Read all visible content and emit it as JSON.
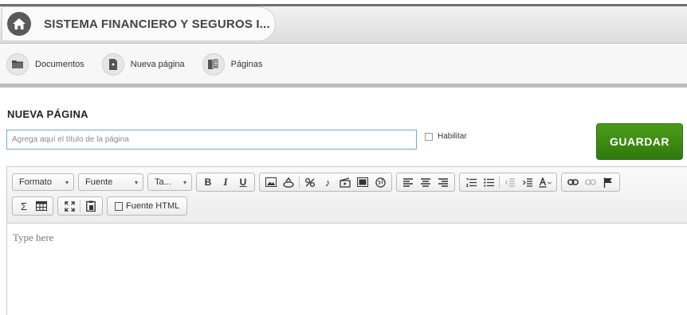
{
  "header": {
    "site_title": "SISTEMA FINANCIERO Y SEGUROS I..."
  },
  "nav": {
    "items": [
      {
        "label": "Documentos",
        "icon": "folder-icon"
      },
      {
        "label": "Nueva página",
        "icon": "new-page-icon"
      },
      {
        "label": "Páginas",
        "icon": "pages-icon"
      }
    ]
  },
  "page": {
    "heading": "NUEVA PÁGINA",
    "title_placeholder": "Agrega aquí el título de la página",
    "enable_label": "Habilitar",
    "enable_checked": false,
    "save_label": "GUARDAR"
  },
  "editor": {
    "format_label": "Formato",
    "font_label": "Fuente",
    "size_label": "Ta...",
    "bold": "B",
    "italic": "I",
    "underline": "U",
    "source_label": "Fuente HTML",
    "placeholder": "Type here"
  },
  "colors": {
    "save_button": "#3a8a12",
    "input_border": "#7aa3d6",
    "header_dark": "#6f6f6f"
  }
}
